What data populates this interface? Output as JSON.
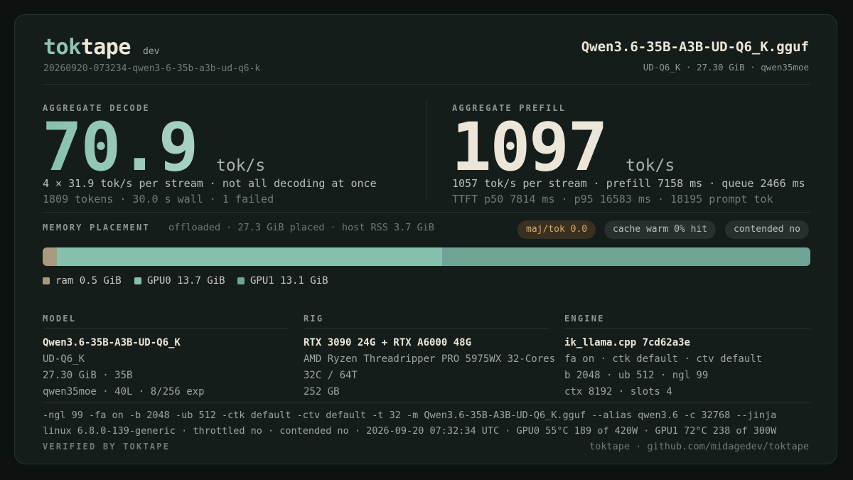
{
  "header": {
    "brand_left": "tok",
    "brand_right": "tape",
    "env": "dev",
    "run_id": "20260920-073234-qwen3-6-35b-a3b-ud-q6-k",
    "model_file": "Qwen3.6-35B-A3B-UD-Q6_K.gguf",
    "model_meta": "UD-Q6_K · 27.30 GiB · qwen35moe"
  },
  "decode": {
    "label": "AGGREGATE DECODE",
    "value": "70.9",
    "unit": "tok/s",
    "line1": "4 × 31.9 tok/s per stream · not all decoding at once",
    "line2": "1809 tokens · 30.0 s wall · 1 failed"
  },
  "prefill": {
    "label": "AGGREGATE PREFILL",
    "value": "1097",
    "unit": "tok/s",
    "line1": "1057 tok/s per stream · prefill 7158 ms · queue 2466 ms",
    "line2": "TTFT p50 7814 ms · p95 16583 ms · 18195 prompt tok"
  },
  "memory": {
    "label": "MEMORY PLACEMENT",
    "note": "offloaded · 27.3 GiB placed · host RSS 3.7 GiB",
    "pills": [
      "maj/tok 0.0",
      "cache warm 0% hit",
      "contended no"
    ],
    "segments": [
      {
        "name": "ram",
        "gib": 0.5,
        "label": "ram 0.5 GiB",
        "color": "#a89a80"
      },
      {
        "name": "GPU0",
        "gib": 13.7,
        "label": "GPU0 13.7 GiB",
        "color": "#86c0ad"
      },
      {
        "name": "GPU1",
        "gib": 13.1,
        "label": "GPU1 13.1 GiB",
        "color": "#6fa496"
      }
    ]
  },
  "columns": {
    "model": {
      "label": "MODEL",
      "lines": [
        "Qwen3.6-35B-A3B-UD-Q6_K",
        "UD-Q6_K",
        "27.30 GiB · 35B",
        "qwen35moe · 40L · 8/256 exp"
      ]
    },
    "rig": {
      "label": "RIG",
      "lines": [
        "RTX 3090 24G + RTX A6000 48G",
        "AMD Ryzen Threadripper PRO 5975WX 32-Cores",
        "32C / 64T",
        "252 GB"
      ]
    },
    "engine": {
      "label": "ENGINE",
      "lines": [
        "ik_llama.cpp 7cd62a3e",
        "fa on · ctk default · ctv default",
        "b 2048 · ub 512 · ngl 99",
        "ctx 8192 · slots 4"
      ]
    }
  },
  "footer": {
    "cmd": "-ngl 99  -fa on  -b 2048  -ub 512  -ctk default  -ctv default  -t 32  -m Qwen3.6-35B-A3B-UD-Q6_K.gguf  --alias qwen3.6  -c 32768  --jinja",
    "sys": "linux 6.8.0-139-generic · throttled no · contended no · 2026-09-20 07:32:34 UTC · GPU0 55°C 189 of 420W · GPU1 72°C 238 of 300W",
    "verified": "VERIFIED BY TOKTAPE",
    "link": "toktape · github.com/midagedev/toktape"
  }
}
